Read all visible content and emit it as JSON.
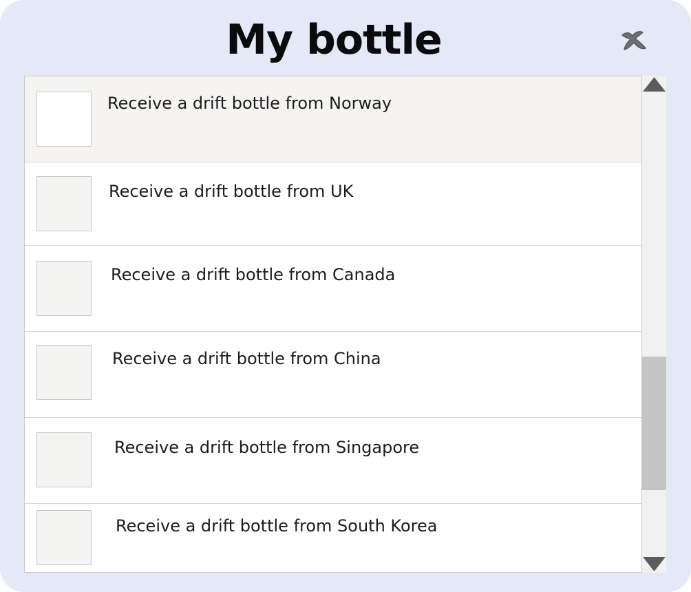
{
  "dialog": {
    "title": "My bottle",
    "close_icon": "close-x-icon"
  },
  "bottles": [
    {
      "label": "Receive a drift bottle from Norway",
      "selected": true
    },
    {
      "label": "Receive a drift bottle from UK",
      "selected": false
    },
    {
      "label": "Receive a drift bottle from Canada",
      "selected": false
    },
    {
      "label": "Receive a drift bottle from China",
      "selected": false
    },
    {
      "label": "Receive a drift bottle from Singapore",
      "selected": false
    },
    {
      "label": "Receive a drift bottle from South Korea",
      "selected": false
    }
  ],
  "scrollbar": {
    "up_icon": "triangle-up-icon",
    "down_icon": "triangle-down-icon",
    "position_fraction": 0.6
  },
  "colors": {
    "panel_background": "#e4e8f7",
    "selected_row": "#f5f4f2",
    "scroll_thumb": "#c4c4c4"
  }
}
